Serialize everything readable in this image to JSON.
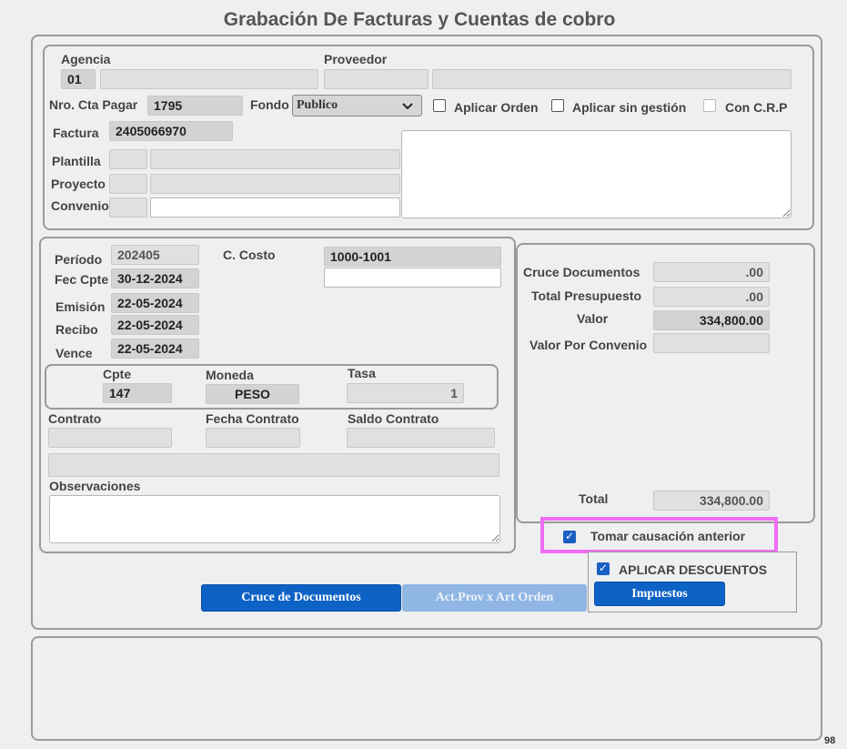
{
  "title": "Grabación De Facturas  y Cuentas de cobro",
  "header": {
    "agencia_label": "Agencia",
    "agencia_code": "01",
    "proveedor_label": "Proveedor",
    "nro_cta_label": "Nro. Cta Pagar",
    "nro_cta_value": "1795",
    "fondo_label": "Fondo",
    "fondo_value": "Publico",
    "aplicar_orden_label": "Aplicar Orden",
    "aplicar_sin_gestion_label": "Aplicar sin gestión",
    "con_crp_label": "Con C.R.P",
    "factura_label": "Factura",
    "factura_value": "2405066970",
    "plantilla_label": "Plantilla",
    "proyecto_label": "Proyecto",
    "convenio_label": "Convenio"
  },
  "details": {
    "periodo_label": "Período",
    "periodo_value": "202405",
    "c_costo_label": "C. Costo",
    "c_costo_value": "1000-1001",
    "fec_cpte_label": "Fec Cpte",
    "fec_cpte_value": "30-12-2024",
    "emision_label": "Emisión",
    "emision_value": "22-05-2024",
    "recibo_label": "Recibo",
    "recibo_value": "22-05-2024",
    "vence_label": "Vence",
    "vence_value": "22-05-2024",
    "cpte_label": "Cpte",
    "cpte_value": "147",
    "moneda_label": "Moneda",
    "moneda_value": "PESO",
    "tasa_label": "Tasa",
    "tasa_value": "1",
    "contrato_label": "Contrato",
    "fecha_contrato_label": "Fecha Contrato",
    "saldo_contrato_label": "Saldo Contrato",
    "observaciones_label": "Observaciones"
  },
  "totals": {
    "cruce_label": "Cruce Documentos",
    "cruce_value": ".00",
    "total_presupuesto_label": "Total Presupuesto",
    "total_presupuesto_value": ".00",
    "valor_label": "Valor",
    "valor_value": "334,800.00",
    "valor_convenio_label": "Valor Por Convenio",
    "total_label": "Total",
    "total_value": "334,800.00"
  },
  "options": {
    "tomar_causacion_label": "Tomar causación anterior",
    "tomar_causacion_checked": true,
    "aplicar_descuentos_label": "APLICAR DESCUENTOS",
    "aplicar_descuentos_checked": true
  },
  "buttons": {
    "cruce_documentos": "Cruce de Documentos",
    "act_prov": "Act.Prov x Art Orden",
    "impuestos": "Impuestos"
  },
  "footer": {
    "page_number": "98"
  },
  "colors": {
    "primary_button": "#0d62c6",
    "disabled_button": "#90b6e3",
    "highlight": "#f26cf2"
  }
}
